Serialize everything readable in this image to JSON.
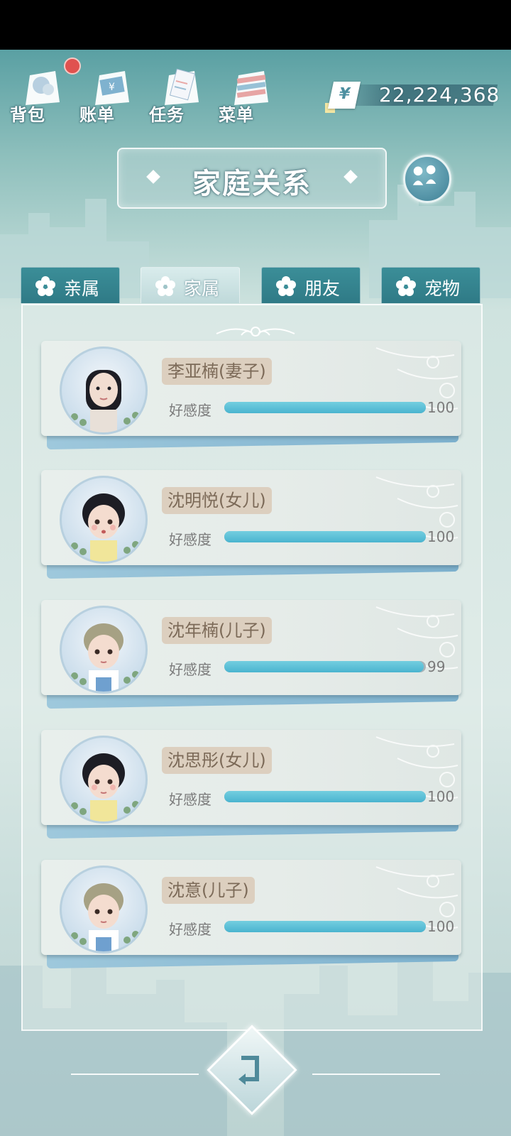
{
  "topbar": {
    "menu": [
      {
        "label": "背包",
        "icon": "backpack-icon",
        "notification": true
      },
      {
        "label": "账单",
        "icon": "bill-icon",
        "notification": false
      },
      {
        "label": "任务",
        "icon": "task-icon",
        "notification": false
      },
      {
        "label": "菜单",
        "icon": "menu-icon",
        "notification": false
      }
    ],
    "currency_symbol": "¥",
    "currency_amount": "22,224,368"
  },
  "title": "家庭关系",
  "tabs": [
    {
      "label": "亲属",
      "active": false
    },
    {
      "label": "家属",
      "active": true
    },
    {
      "label": "朋友",
      "active": false
    },
    {
      "label": "宠物",
      "active": false
    }
  ],
  "affection_label": "好感度",
  "members": [
    {
      "name": "李亚楠(妻子)",
      "affection": 100,
      "max": 100,
      "avatar": "woman-portrait"
    },
    {
      "name": "沈明悦(女儿)",
      "affection": 100,
      "max": 100,
      "avatar": "girl-portrait"
    },
    {
      "name": "沈年楠(儿子)",
      "affection": 99,
      "max": 100,
      "avatar": "boy-portrait"
    },
    {
      "name": "沈思彤(女儿)",
      "affection": 100,
      "max": 100,
      "avatar": "girl-portrait"
    },
    {
      "name": "沈意(儿子)",
      "affection": 100,
      "max": 100,
      "avatar": "boy-portrait"
    }
  ],
  "colors": {
    "bar_fill": "#4ab4cf",
    "name_tag": "#dccfbf",
    "notification": "#e0524f"
  }
}
